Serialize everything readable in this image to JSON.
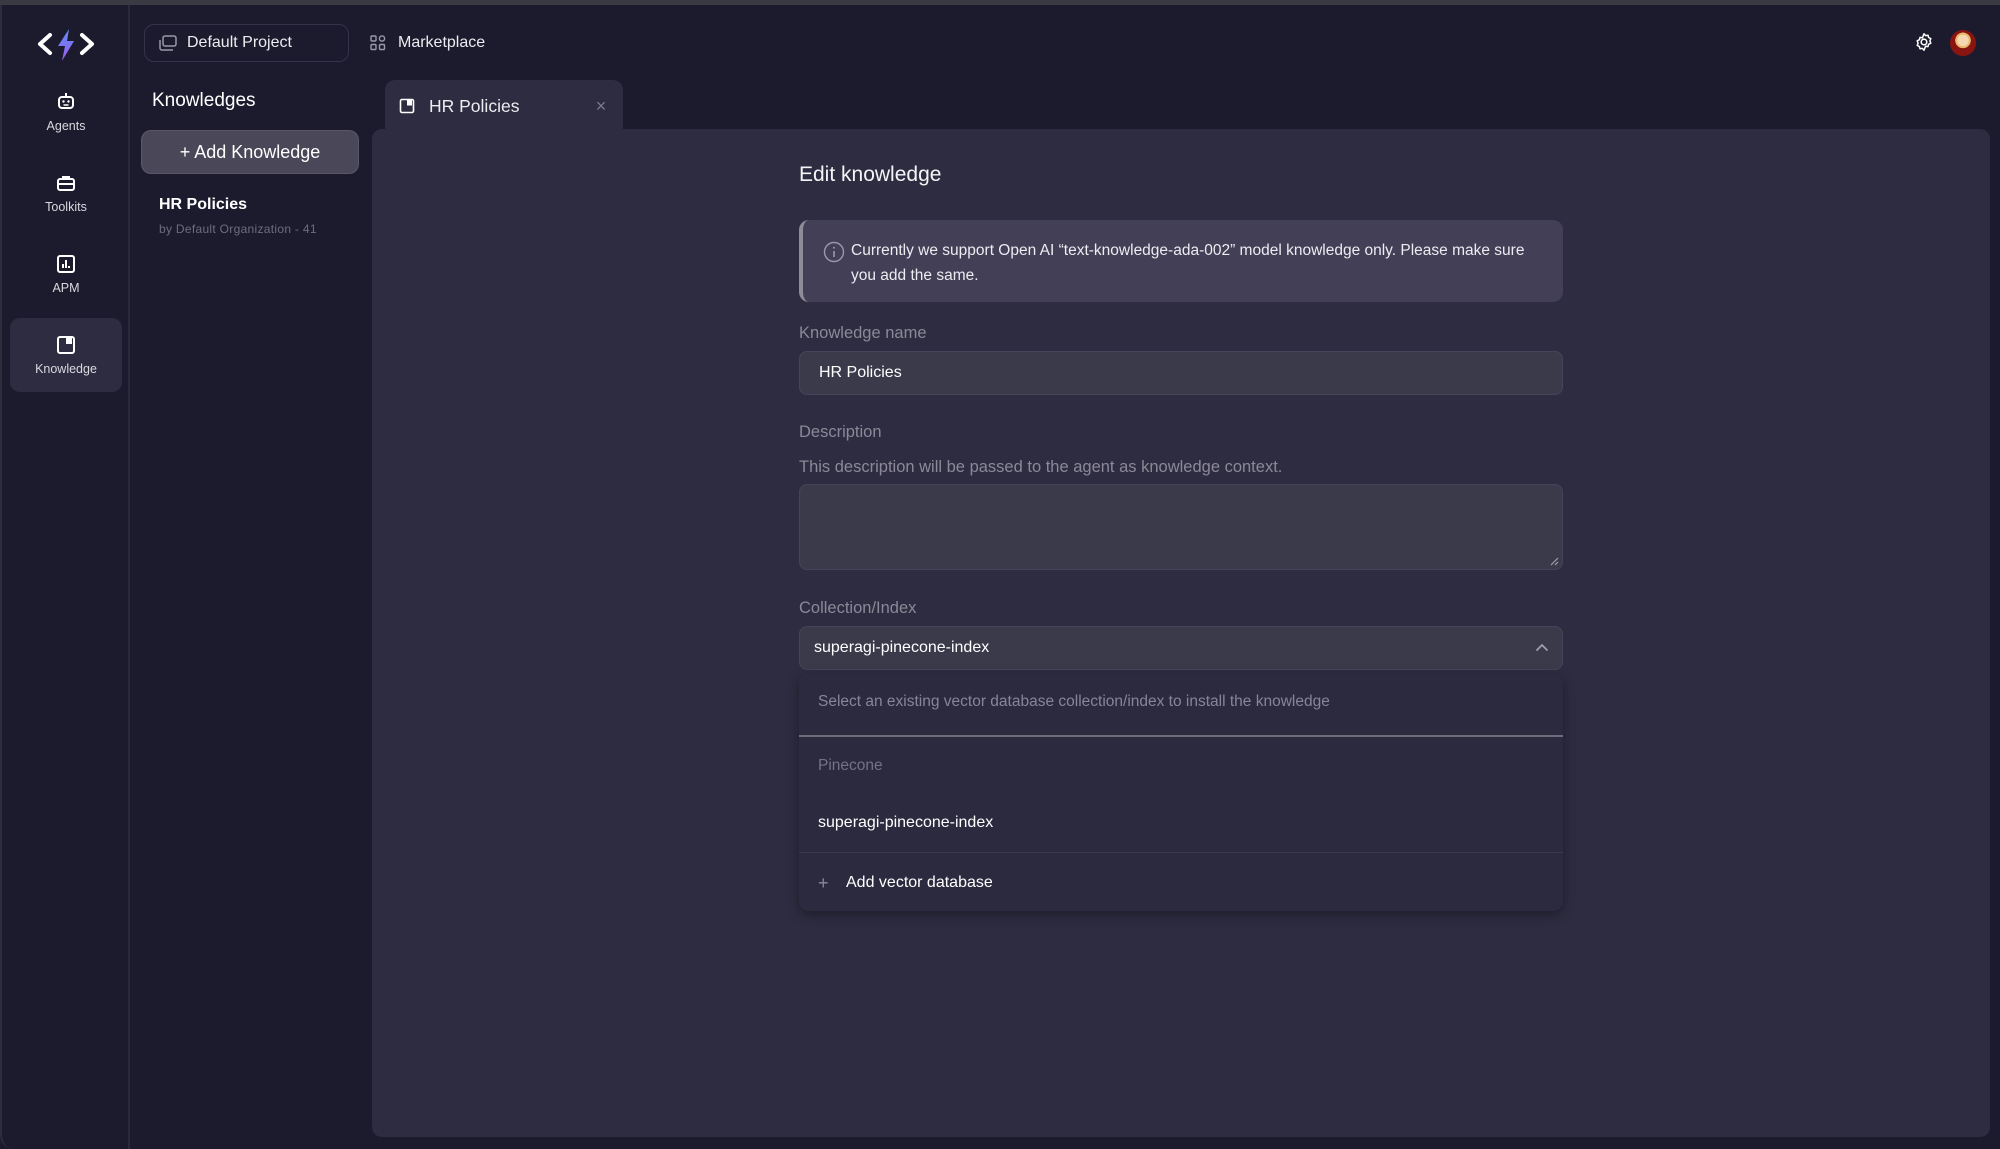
{
  "rail": {
    "items": [
      {
        "label": "Agents",
        "icon": "robot-icon"
      },
      {
        "label": "Toolkits",
        "icon": "toolbox-icon"
      },
      {
        "label": "APM",
        "icon": "bar-chart-icon"
      },
      {
        "label": "Knowledge",
        "icon": "book-icon",
        "active": true
      }
    ]
  },
  "topbar": {
    "project_label": "Default Project",
    "marketplace_label": "Marketplace"
  },
  "knowledge_list": {
    "title": "Knowledges",
    "add_button": "+ Add Knowledge",
    "items": [
      {
        "name": "HR Policies",
        "by": "by Default Organization - 41"
      }
    ]
  },
  "tabs": [
    {
      "label": "HR Policies",
      "close": "×"
    }
  ],
  "form": {
    "title": "Edit knowledge",
    "info": "Currently we support Open AI “text-knowledge-ada-002” model knowledge only. Please make sure you add the same.",
    "name_label": "Knowledge name",
    "name_value": "HR Policies",
    "description_label": "Description",
    "description_help": "This description will be passed to the agent as knowledge context.",
    "description_value": "",
    "collection_label": "Collection/Index",
    "collection_value": "superagi-pinecone-index",
    "dropdown": {
      "search_placeholder": "Select an existing vector database collection/index to install the knowledge",
      "group": "Pinecone",
      "options": [
        "superagi-pinecone-index"
      ],
      "add_label": "Add vector database",
      "add_icon": "+"
    }
  },
  "colors": {
    "background": "#1c1b2d",
    "panel": "#2e2c40",
    "accent_logo": "#7b6cf6"
  }
}
